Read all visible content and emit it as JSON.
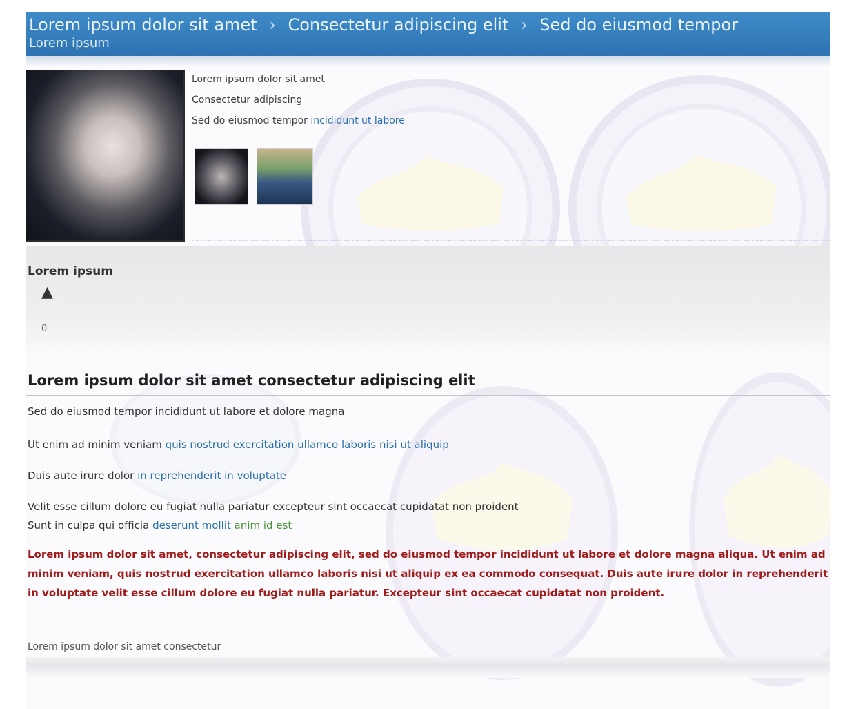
{
  "header": {
    "breadcrumbs": [
      "Lorem ipsum dolor sit amet",
      "Consectetur adipiscing elit",
      "Sed do eiusmod tempor"
    ],
    "separator": "›",
    "sub": "Lorem ipsum"
  },
  "profile": {
    "line1": "Lorem ipsum dolor sit amet",
    "line2": "Consectetur adipiscing",
    "line3_text": "Sed do eiusmod tempor",
    "line3_link": "incididunt ut labore"
  },
  "rating": {
    "label": "Lorem ipsum",
    "up": "▲",
    "count": "0"
  },
  "main": {
    "title": "Lorem ipsum dolor sit amet consectetur adipiscing elit",
    "row1": "Sed do eiusmod tempor incididunt ut labore et dolore magna",
    "row2_text": "Ut enim ad minim veniam",
    "row2_link": "quis nostrud exercitation ullamco laboris nisi ut aliquip",
    "row3_text": "Duis aute irure dolor",
    "row3_link": "in reprehenderit in voluptate",
    "row4": "Velit esse cillum dolore eu fugiat nulla pariatur excepteur sint occaecat cupidatat non proident",
    "row5_text": "Sunt in culpa qui officia",
    "row5_link": "deserunt mollit",
    "row5_green": "anim id est",
    "warning": "Lorem ipsum dolor sit amet, consectetur adipiscing elit, sed do eiusmod tempor incididunt ut labore et dolore magna aliqua. Ut enim ad minim veniam, quis nostrud exercitation ullamco laboris nisi ut aliquip ex ea commodo consequat. Duis aute irure dolor in reprehenderit in voluptate velit esse cillum dolore eu fugiat nulla pariatur. Excepteur sint occaecat cupidatat non proident.",
    "footer": "Lorem ipsum dolor sit amet consectetur"
  },
  "colors": {
    "header_blue": "#2e73b2",
    "link_blue": "#2a6fb0",
    "warning_red": "#a11b1b",
    "link_green": "#4f8f3a"
  }
}
